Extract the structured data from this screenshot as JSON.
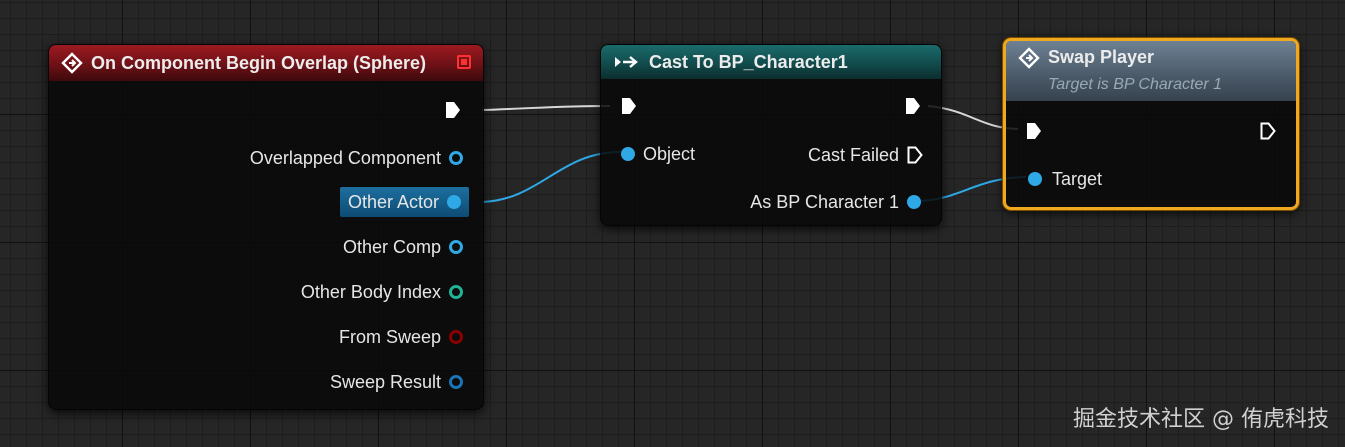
{
  "colors": {
    "object_pin": "#2fa8e6",
    "struct_pin": "#1a74b6",
    "int_pin": "#20b394",
    "bool_pin": "#8b0000",
    "exec_pin": "#ffffff",
    "selection": "#f0a81e"
  },
  "nodes": {
    "overlap_event": {
      "title": "On Component Begin Overlap (Sphere)",
      "icon": "event-diamond-icon",
      "pins": [
        {
          "label": "Overlapped Component",
          "icon": "object-pin-icon"
        },
        {
          "label": "Other Actor",
          "icon": "object-pin-icon"
        },
        {
          "label": "Other Comp",
          "icon": "object-pin-icon"
        },
        {
          "label": "Other Body Index",
          "icon": "int-pin-icon"
        },
        {
          "label": "From Sweep",
          "icon": "bool-pin-icon"
        },
        {
          "label": "Sweep Result",
          "icon": "struct-pin-icon"
        }
      ]
    },
    "cast_node": {
      "title": "Cast To BP_Character1",
      "icon": "cast-icon",
      "input_object_label": "Object",
      "cast_failed_label": "Cast Failed",
      "output_label": "As BP Character 1"
    },
    "swap_player": {
      "title": "Swap Player",
      "subtitle": "Target is BP Character 1",
      "icon": "function-icon",
      "target_label": "Target"
    }
  },
  "watermark": "掘金技术社区 @ 侑虎科技"
}
